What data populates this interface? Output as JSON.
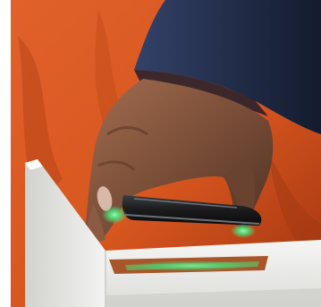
{
  "scene": {
    "subject": "hand-holding-phone-over-scanner",
    "colors": {
      "jacket_orange": "#d8561f",
      "jacket_orange_dark": "#9e3410",
      "sleeve_navy": "#1f2a44",
      "sleeve_navy_light": "#34426a",
      "skin": "#7a4e38",
      "skin_light": "#a36d4f",
      "skin_dark": "#4e3023",
      "phone_body": "#1a1a1c",
      "phone_edge": "#6b6f76",
      "glow_green": "#47e07a",
      "kiosk_white": "#eeeeec",
      "kiosk_shadow": "#c9c9c6",
      "scanner_window": "#a8552a"
    }
  }
}
